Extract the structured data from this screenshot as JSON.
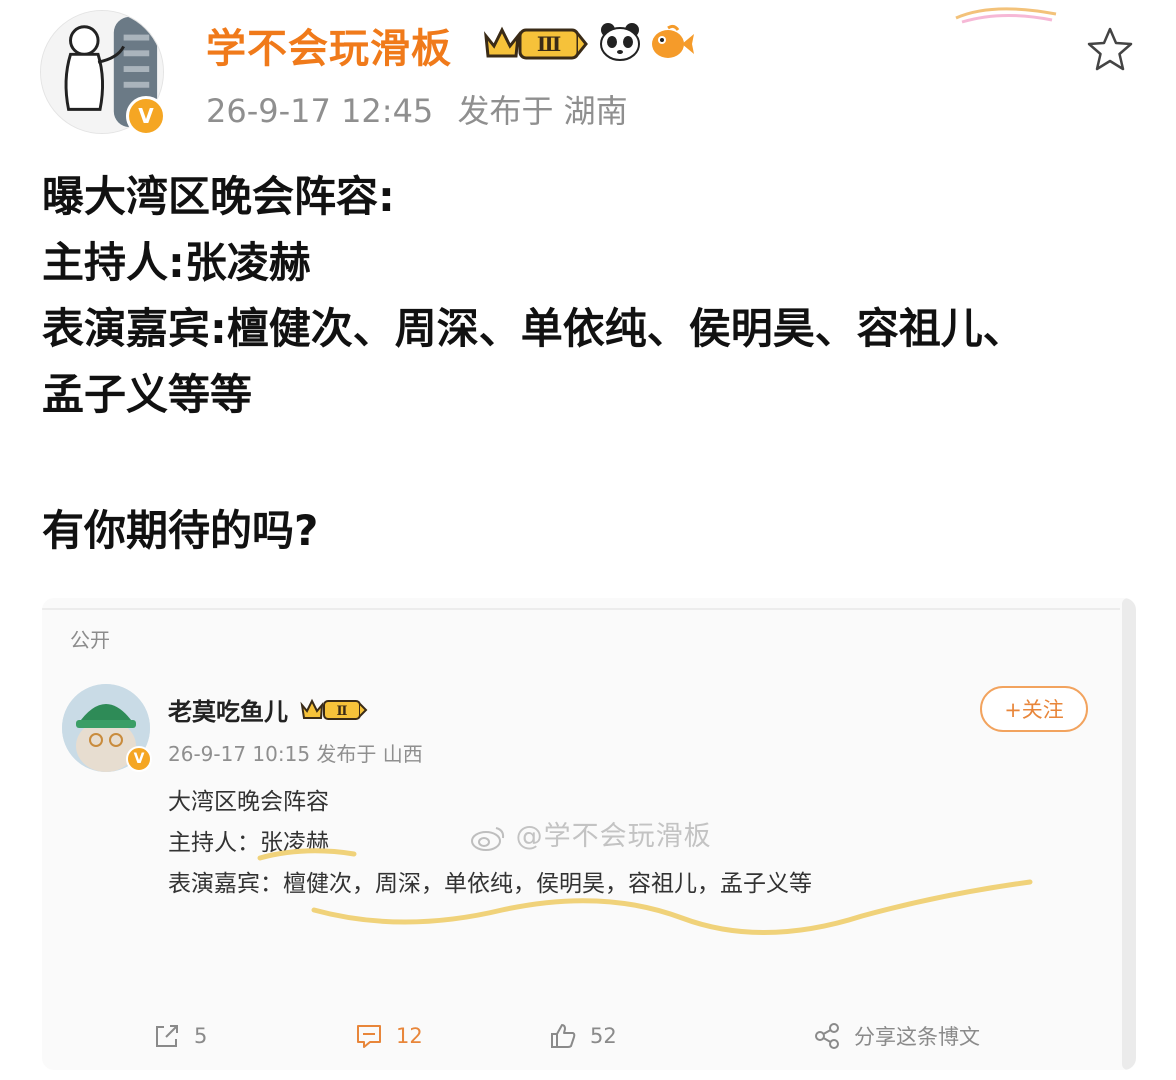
{
  "post": {
    "author": {
      "name": "学不会玩滑板",
      "verified_mark": "V",
      "vip_level": "Ⅲ",
      "avatar_icon": "sketch-figure-avatar",
      "badge_icons": [
        "crown-vip-badge-icon",
        "panda-emoji-icon",
        "goldfish-emoji-icon"
      ]
    },
    "time": "26-9-17 12:45",
    "location_text": "发布于 湖南",
    "lines": [
      "曝大湾区晚会阵容:",
      "主持人:张凌赫",
      "表演嘉宾:檀健次、周深、单依纯、侯明昊、容祖儿、",
      "孟子义等等",
      "有你期待的吗?"
    ],
    "favorite_icon": "star-outline-icon"
  },
  "embedded": {
    "visibility": "公开",
    "author": {
      "name": "老莫吃鱼儿",
      "verified_mark": "V",
      "vip_level": "Ⅱ",
      "avatar_icon": "cat-green-hat-avatar"
    },
    "meta": "26-9-17 10:15 发布于 山西",
    "follow_label": "+关注",
    "lines": [
      "大湾区晚会阵容",
      "主持人：张凌赫",
      "表演嘉宾：檀健次，周深，单依纯，侯明昊，容祖儿，孟子义等"
    ],
    "watermark": "@学不会玩滑板",
    "actions": {
      "repost": {
        "icon": "repost-icon",
        "count": "5"
      },
      "comment": {
        "icon": "comment-icon",
        "count": "12"
      },
      "like": {
        "icon": "thumbs-up-icon",
        "count": "52"
      },
      "share": {
        "icon": "share-icon",
        "label": "分享这条博文"
      }
    }
  },
  "colors": {
    "username": "#f07a1a",
    "meta": "#8f8f8f",
    "highlight_squiggle": "#f0d27a",
    "comment_active": "#e8863a"
  }
}
